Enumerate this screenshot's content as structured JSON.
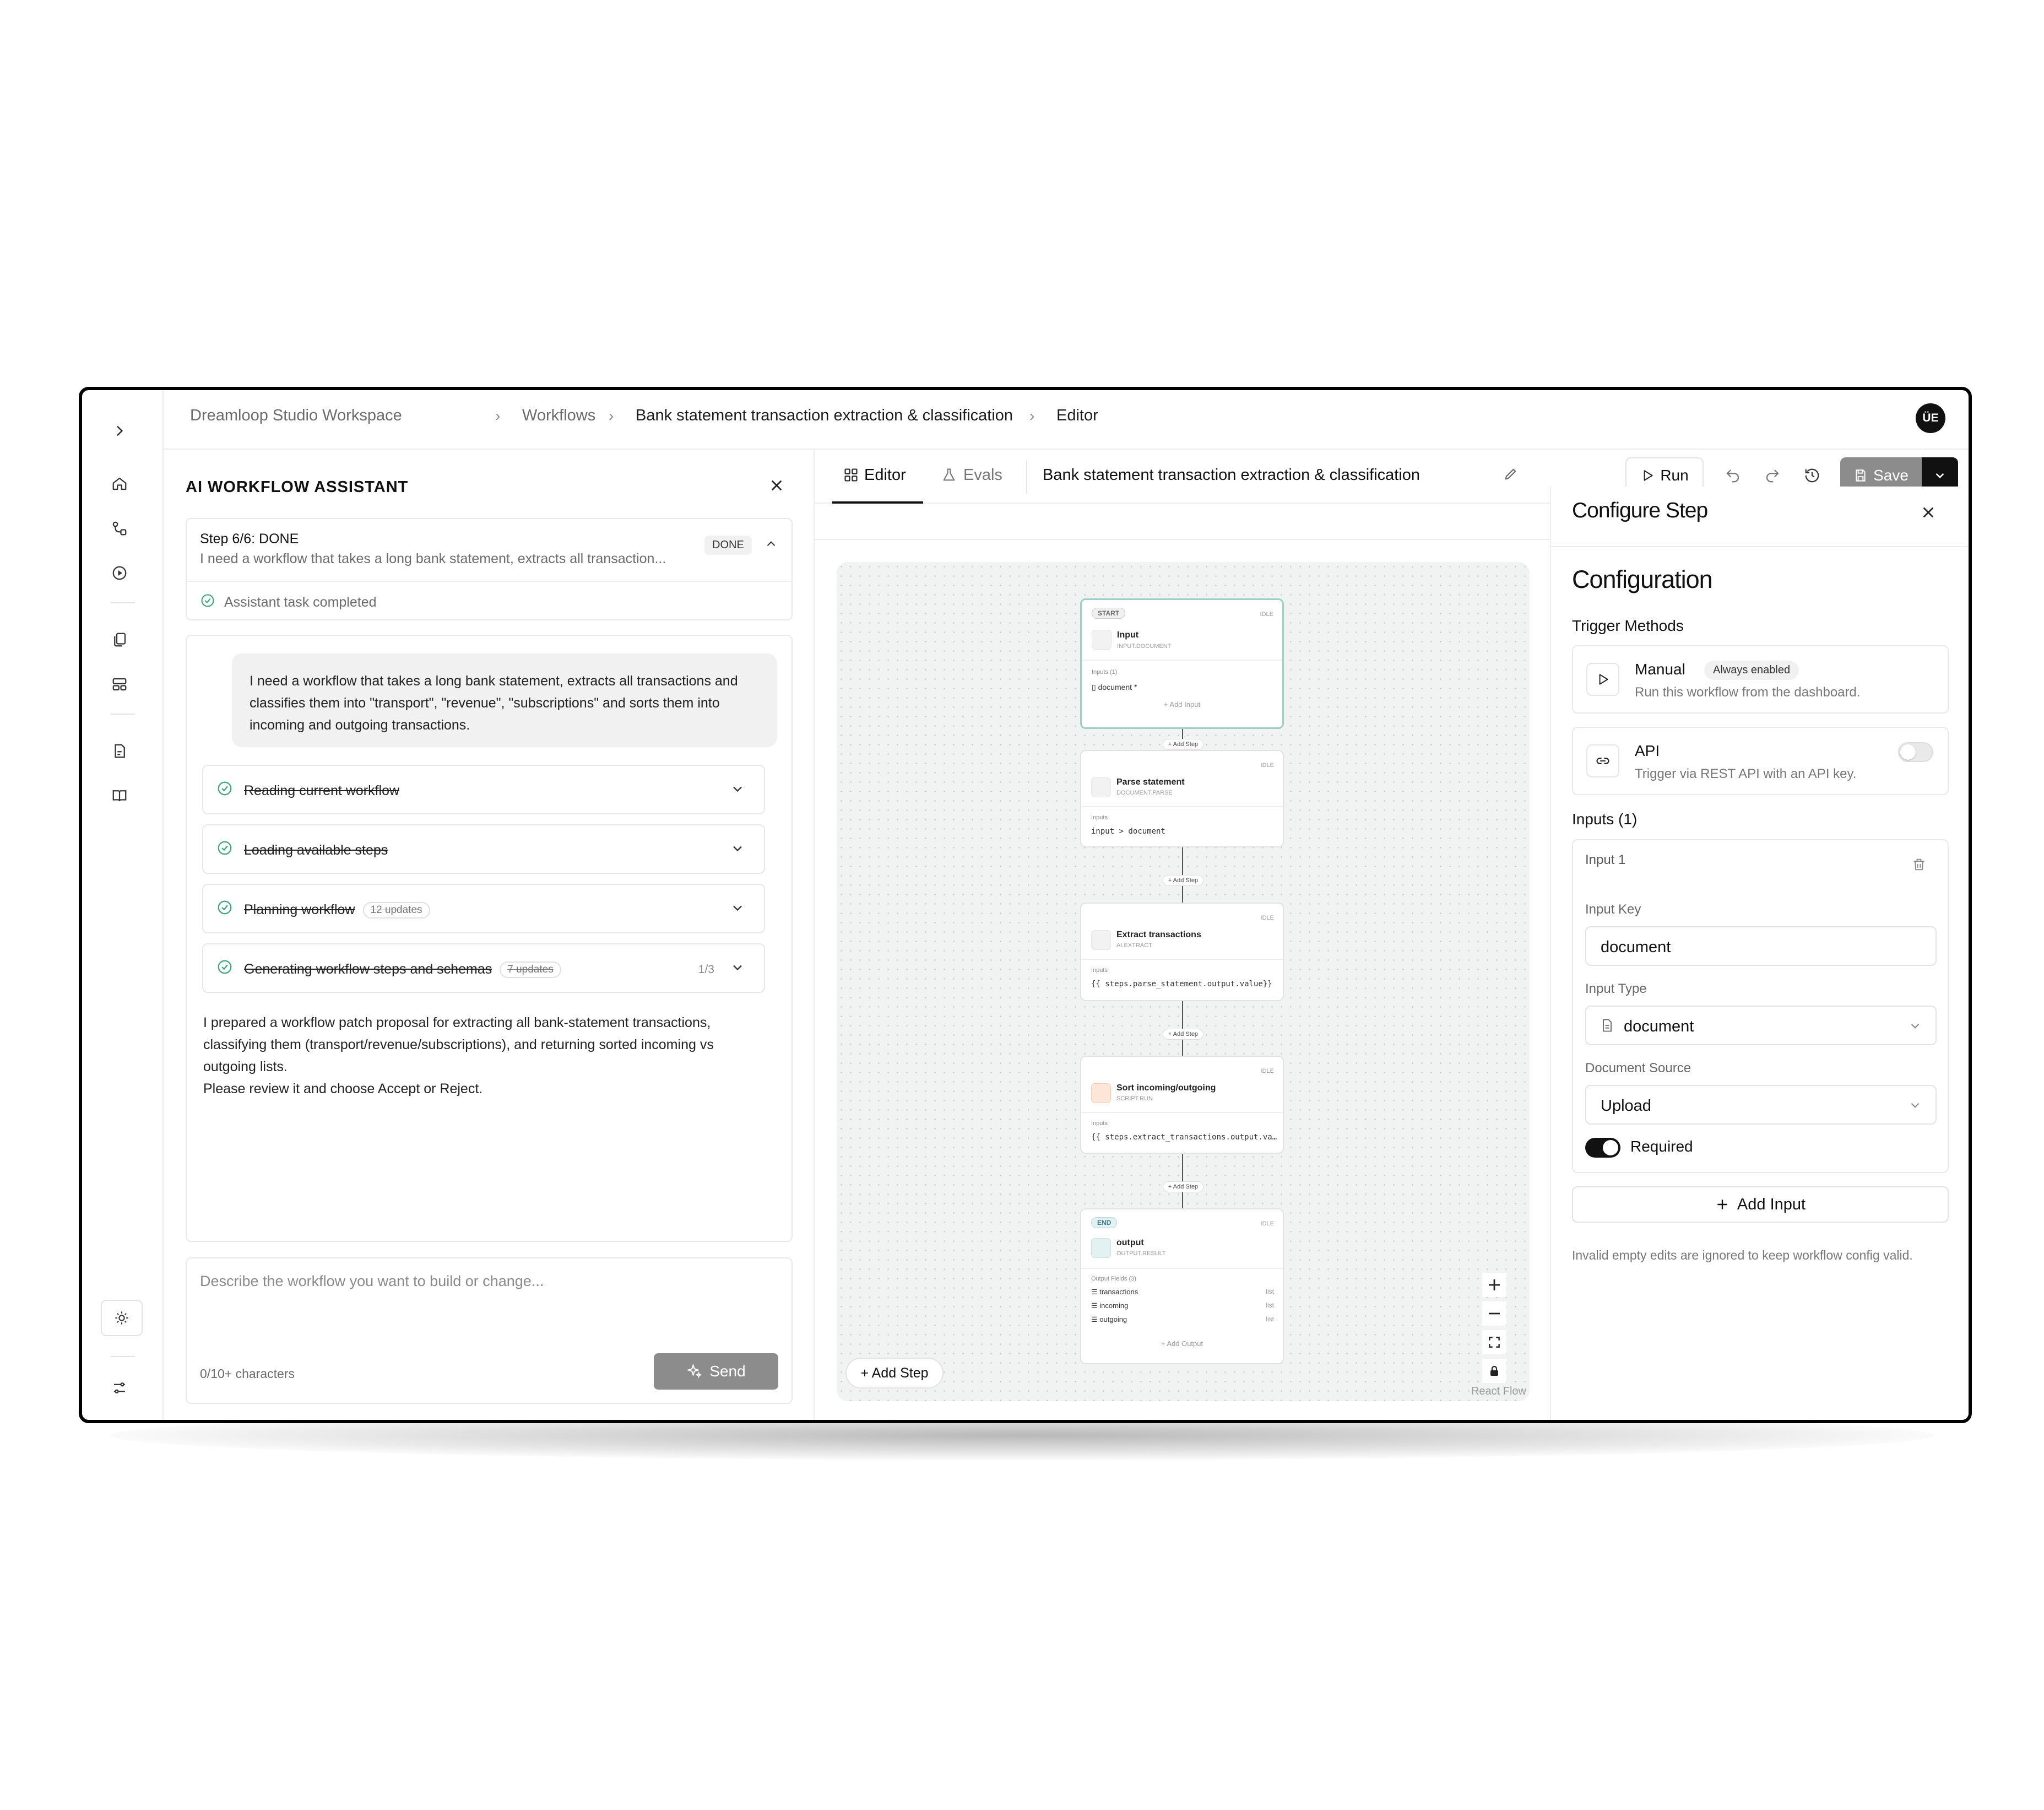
{
  "breadcrumb": {
    "workspace": "Dreamloop Studio Workspace",
    "workflows": "Workflows",
    "workflow": "Bank statement transaction extraction & classification",
    "current": "Editor"
  },
  "user": {
    "initials": "ÜE"
  },
  "assistant": {
    "title": "AI WORKFLOW ASSISTANT",
    "step_title": "Step 6/6: DONE",
    "step_preview": "I need a workflow that takes a long bank statement, extracts all transaction...",
    "step_badge": "DONE",
    "completed": "Assistant task completed",
    "user_message": "I need a workflow that takes a long bank statement, extracts all transactions and classifies them into \"transport\", \"revenue\", \"subscriptions\" and sorts them into incoming and outgoing transactions.",
    "tasks": [
      {
        "label": "Reading current workflow",
        "pill": "",
        "count": ""
      },
      {
        "label": "Loading available steps",
        "pill": "",
        "count": ""
      },
      {
        "label": "Planning workflow",
        "pill": "12 updates",
        "count": ""
      },
      {
        "label": "Generating workflow steps and schemas",
        "pill": "7 updates",
        "count": "1/3"
      }
    ],
    "reply_line1": "I prepared a workflow patch proposal for extracting all bank-statement transactions, classifying them (transport/revenue/subscriptions), and returning sorted incoming vs outgoing lists.",
    "reply_line2": "Please review it and choose Accept or Reject.",
    "input_placeholder": "Describe the workflow you want to build or change...",
    "char_count": "0/10+ characters",
    "send_label": "Send"
  },
  "editor": {
    "tab_editor": "Editor",
    "tab_evals": "Evals",
    "workflow_name": "Bank statement transaction extraction & classification",
    "run_label": "Run",
    "save_label": "Save",
    "add_step_label": "+ Add Step",
    "attribution": "React Flow"
  },
  "nodes": {
    "input": {
      "badge": "START",
      "status": "IDLE",
      "title": "Input",
      "type": "INPUT.DOCUMENT",
      "inputs_label": "Inputs (1)",
      "field": "document",
      "add": "+ Add Input"
    },
    "parse": {
      "status": "IDLE",
      "title": "Parse statement",
      "type": "DOCUMENT.PARSE",
      "inputs_label": "Inputs",
      "field": "input > document"
    },
    "extract": {
      "status": "IDLE",
      "title": "Extract transactions",
      "type": "AI.EXTRACT",
      "inputs_label": "Inputs",
      "field": "{{ steps.parse_statement.output.value}}"
    },
    "sort": {
      "status": "IDLE",
      "title": "Sort incoming/outgoing",
      "type": "SCRIPT.RUN",
      "inputs_label": "Inputs",
      "field": "{{ steps.extract_transactions.output.value}}"
    },
    "output": {
      "badge": "END",
      "status": "IDLE",
      "title": "output",
      "type": "OUTPUT.RESULT",
      "fields_label": "Output Fields (3)",
      "fields": [
        {
          "name": "transactions",
          "kind": "list"
        },
        {
          "name": "incoming",
          "kind": "list"
        },
        {
          "name": "outgoing",
          "kind": "list"
        }
      ],
      "add": "+ Add Output"
    },
    "connector_label": "+ Add Step"
  },
  "config": {
    "panel_title": "Configure Step",
    "heading": "Configuration",
    "trigger_title": "Trigger Methods",
    "manual_title": "Manual",
    "manual_badge": "Always enabled",
    "manual_desc": "Run this workflow from the dashboard.",
    "api_title": "API",
    "api_desc": "Trigger via REST API with an API key.",
    "api_enabled": false,
    "inputs_title": "Inputs (1)",
    "input_card_title": "Input 1",
    "input_key_label": "Input Key",
    "input_key_value": "document",
    "input_type_label": "Input Type",
    "input_type_value": "document",
    "doc_source_label": "Document Source",
    "doc_source_value": "Upload",
    "required_label": "Required",
    "required": true,
    "add_input_label": "Add Input",
    "footnote": "Invalid empty edits are ignored to keep workflow config valid."
  },
  "colors": {
    "accent_teal": "#9ad1c4",
    "success_green": "#3aa679",
    "save_bg": "#8c8c8c"
  }
}
